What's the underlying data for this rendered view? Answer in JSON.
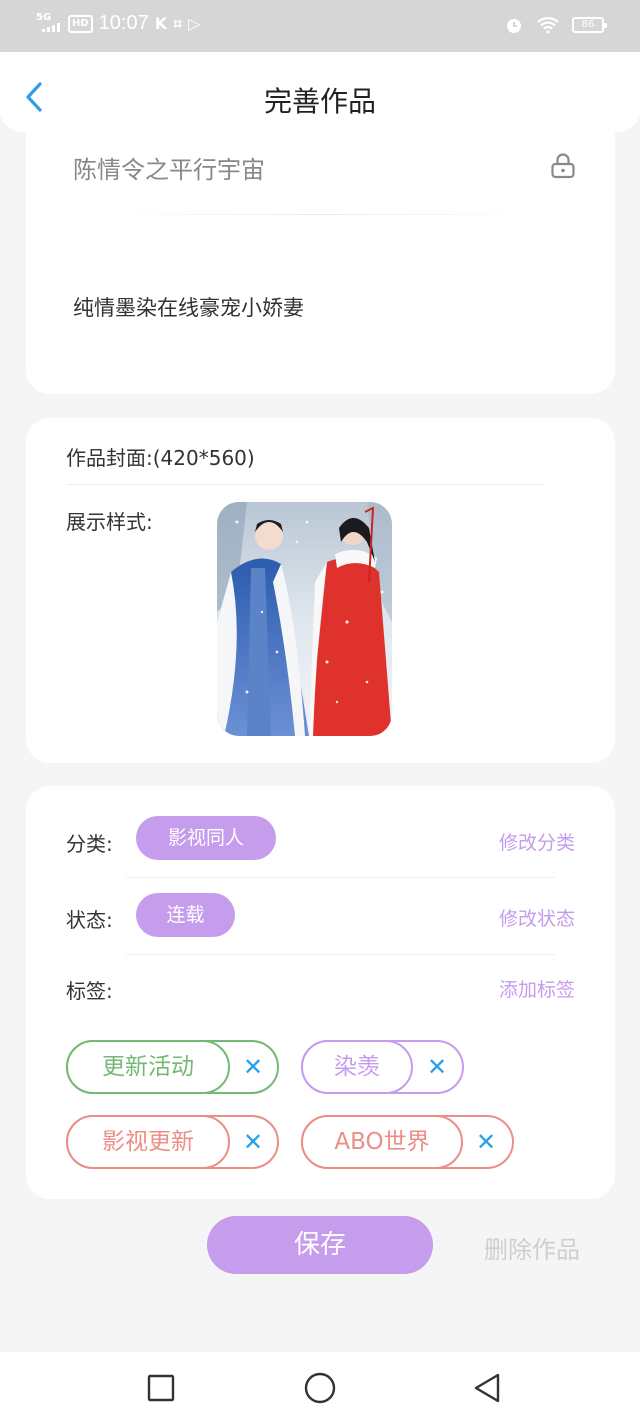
{
  "status_bar": {
    "network": "5G",
    "hd": "HD",
    "time": "10:07",
    "app_icons": [
      "K",
      "⌗",
      "▷"
    ],
    "battery": "86"
  },
  "header": {
    "title": "完善作品"
  },
  "work": {
    "title": "陈情令之平行宇宙",
    "description": "纯情墨染在线豪宠小娇妻"
  },
  "cover": {
    "label": "作品封面:(420*560)",
    "style_label": "展示样式:"
  },
  "meta": {
    "category_label": "分类:",
    "category_value": "影视同人",
    "category_action": "修改分类",
    "status_label": "状态:",
    "status_value": "连载",
    "status_action": "修改状态",
    "tags_label": "标签:",
    "tags_action": "添加标签",
    "tags": [
      {
        "label": "更新活动",
        "color": "#74b874"
      },
      {
        "label": "染羡",
        "color": "#c69cec"
      },
      {
        "label": "影视更新",
        "color": "#ec8d86"
      },
      {
        "label": "ABO世界",
        "color": "#ec8d86"
      }
    ]
  },
  "actions": {
    "save": "保存",
    "delete": "删除作品"
  },
  "colors": {
    "accent": "#c69cec",
    "back_arrow": "#2aa0e6",
    "tag_remove": "#2aa0e6"
  }
}
